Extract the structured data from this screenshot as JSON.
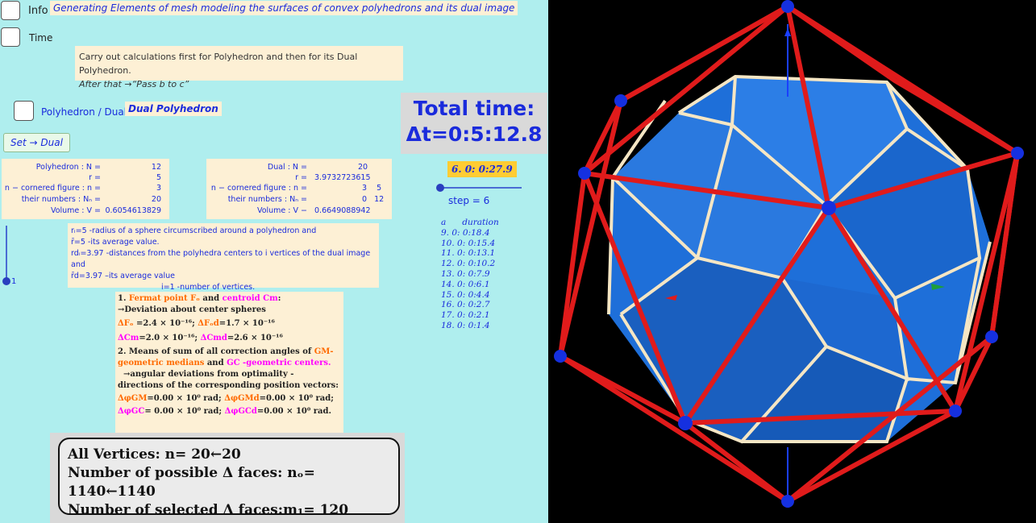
{
  "header": {
    "info_label": "Info",
    "time_label": "Time",
    "title": "Generating Elements of mesh modeling the surfaces of convex polyhedrons and its dual image"
  },
  "instructions": {
    "line1": "Carry out calculations first for Polyhedron and then for its Dual Polyhedron.",
    "line2": "After that →“Pass b to c”"
  },
  "mode": {
    "toggle_label": "Polyhedron / Dual",
    "current": "Dual Polyhedron",
    "set_button": "Set → Dual"
  },
  "total_time": {
    "line1": "Total time:",
    "line2": "Δt=0:5:12.8"
  },
  "polyhedron": {
    "n_label": "Polyhedron : N =",
    "n_value": "12",
    "r_label": "r =",
    "r_value": "5",
    "cornered_label": "n − cornered figure : n =",
    "cornered_value": "3",
    "numbers_label": "their numbers : Nₙ =",
    "numbers_value": "20",
    "volume_label": "Volume : V =",
    "volume_value": "0.6054613829"
  },
  "dual": {
    "n_label": "Dual : N =",
    "n_value": "20",
    "r_label": "r =",
    "r_value": "3.9732723615",
    "cornered_label": "n − cornered figure : n =",
    "cornered_value": "3    5",
    "numbers_label": "their numbers : Nₙ =",
    "numbers_value": "0   12",
    "volume_label": "Volume : V −",
    "volume_value": "0.6649088942"
  },
  "step": {
    "badge": "6.  0: 0:27.9",
    "label": "step = 6",
    "value": 6
  },
  "durations": {
    "header": "a      duration",
    "items": [
      "9.  0: 0:18.4",
      "10.  0: 0:15.4",
      "11.  0: 0:13.1",
      "12.  0: 0:10.2",
      "13.  0: 0:7.9",
      "14.  0: 0:6.1",
      "15.  0: 0:4.4",
      "16.  0: 0:2.7",
      "17.  0: 0:2.1",
      "18.  0: 0:1.4"
    ]
  },
  "radius_info": {
    "l1": "rᵢ=5 -radius of a sphere circumscribed around a polyhedron and",
    "l2": "r̄=5 -its average value.",
    "l3": "rdᵢ=3.97 -distances from the polyhedra centers to i vertices of the dual image and",
    "l4": "r̄d=3.97 –its average value",
    "l5": "i=1    -number of  vertices."
  },
  "vertex_slider": {
    "label": "1",
    "value": 1
  },
  "metrics": {
    "l1a": "1. ",
    "l1b": "Fermat point  Fₒ",
    "l1c": " and  ",
    "l1d": "centroid Cm",
    "l1e": ":",
    "l2": "→Deviation about center spheres",
    "l3a": "ΔFₒ",
    "l3b": " =2.4 × 10⁻¹⁶;  ",
    "l3c": "ΔFₒd",
    "l3d": "=1.7 × 10⁻¹⁶",
    "l4a": "ΔCm",
    "l4b": "=2.0 × 10⁻¹⁶;  ",
    "l4c": "ΔCmd",
    "l4d": "=2.6 × 10⁻¹⁶",
    "l5a": "2. Means of sum of all correction angles of ",
    "l5b": "GM-",
    "l6a": "geometric medians",
    "l6b": " and ",
    "l6c": "GC -geometric centers.",
    "l7": "  →angular deviations from optimality -",
    "l8": "directions of the corresponding position vectors:",
    "l9a": "ΔφGM",
    "l9b": "=0.00 × 10⁰  rad;  ",
    "l9c": "ΔφGMd",
    "l9d": "=0.00 × 10⁰ rad;",
    "l10a": "ΔφGC",
    "l10b": "= 0.00 × 10⁰  rad;  ",
    "l10c": "ΔφGCd",
    "l10d": "=0.00 × 10⁰ rad."
  },
  "summary": {
    "l1": "All Vertices: n= 20←20",
    "l2": "Number of possible Δ faces: nₒ= 1140←1140",
    "l3": "Number of selected Δ faces:m₁= 120"
  },
  "colors": {
    "background": "#afeeee",
    "note": "#fdf0d5",
    "text_blue": "#1a2bdc",
    "badge": "#ffcc33",
    "polyhedron_face": "#1e6fd9",
    "edge_cream": "#f5e6c4",
    "dual_edge": "#e01b1b",
    "vertex": "#1530e0"
  }
}
